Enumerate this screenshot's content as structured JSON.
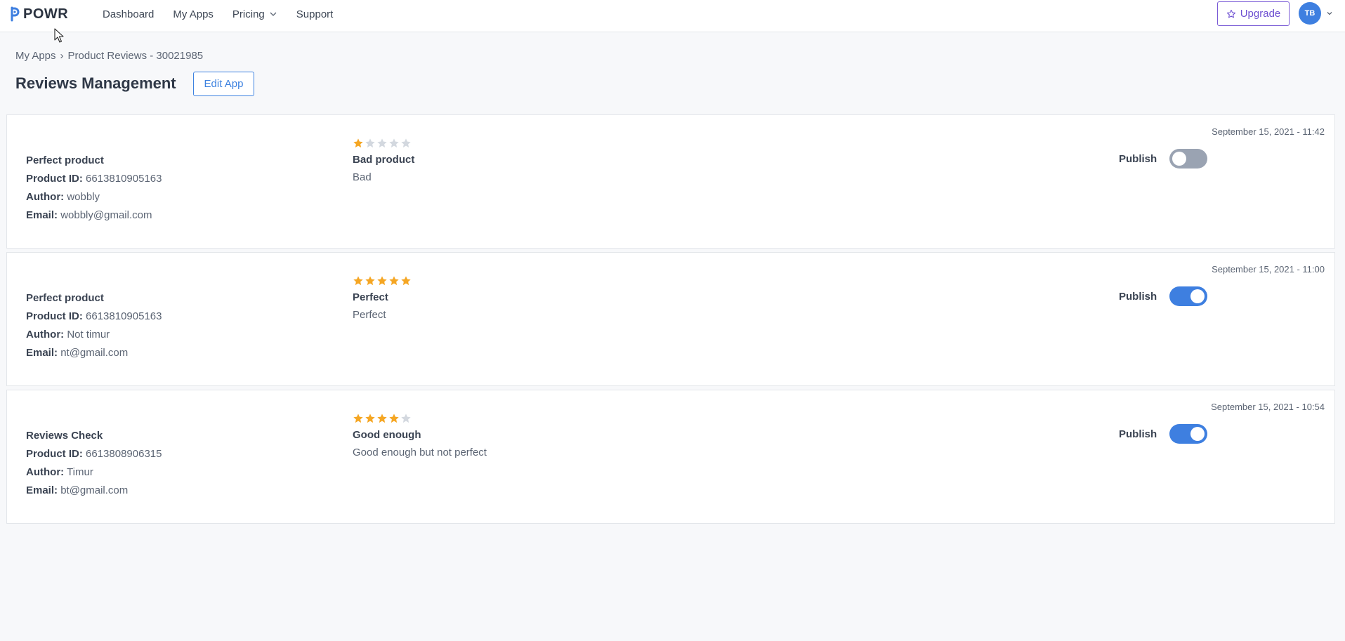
{
  "header": {
    "logo_text": "POWR",
    "nav": [
      {
        "label": "Dashboard"
      },
      {
        "label": "My Apps"
      },
      {
        "label": "Pricing"
      },
      {
        "label": "Support"
      }
    ],
    "upgrade_label": "Upgrade",
    "avatar_initials": "TB"
  },
  "breadcrumb": {
    "parent": "My Apps",
    "separator": "›",
    "current": "Product Reviews - 30021985"
  },
  "page": {
    "title": "Reviews Management",
    "edit_label": "Edit App"
  },
  "labels": {
    "product_id": "Product ID:",
    "author": "Author:",
    "email": "Email:",
    "publish": "Publish"
  },
  "reviews": [
    {
      "product_name": "Perfect product",
      "product_id": "6613810905163",
      "author": "wobbly",
      "email": "wobbly@gmail.com",
      "rating": 1,
      "title": "Bad product",
      "body": "Bad",
      "date": "September 15, 2021 - 11:42",
      "published": false
    },
    {
      "product_name": "Perfect product",
      "product_id": "6613810905163",
      "author": "Not timur",
      "email": "nt@gmail.com",
      "rating": 5,
      "title": "Perfect",
      "body": "Perfect",
      "date": "September 15, 2021 - 11:00",
      "published": true
    },
    {
      "product_name": "Reviews Check",
      "product_id": "6613808906315",
      "author": "Timur",
      "email": "bt@gmail.com",
      "rating": 4,
      "title": "Good enough",
      "body": "Good enough but not perfect",
      "date": "September 15, 2021 - 10:54",
      "published": true
    }
  ],
  "colors": {
    "star_filled": "#f5a623",
    "star_empty": "#d3d8df",
    "toggle_on": "#3e7fe0",
    "toggle_off": "#9aa3b2",
    "accent": "#3e7fe0",
    "upgrade": "#6d4fd1"
  }
}
